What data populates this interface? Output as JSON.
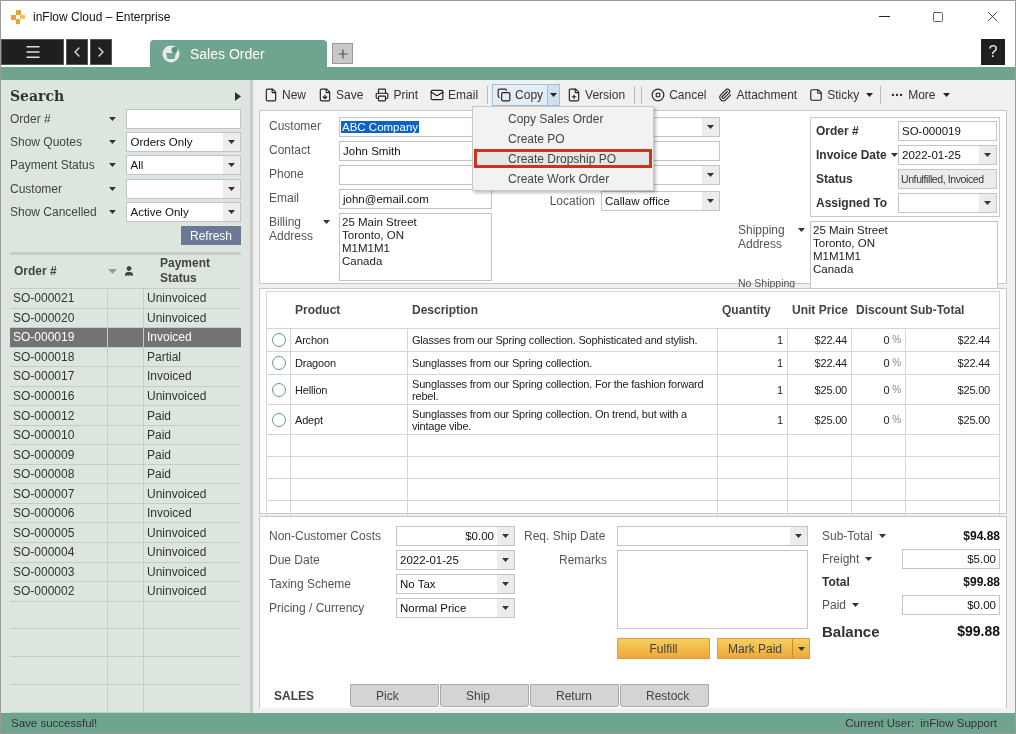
{
  "window": {
    "title": "inFlow Cloud – Enterprise"
  },
  "tabs": [
    {
      "label": "Sales Order",
      "selected": true
    }
  ],
  "help": "?",
  "search": {
    "title": "Search",
    "filters": [
      {
        "label": "Order #",
        "kind": "text"
      },
      {
        "label": "Show Quotes",
        "value": "Orders Only",
        "kind": "select"
      },
      {
        "label": "Payment Status",
        "value": "All",
        "kind": "select"
      },
      {
        "label": "Customer",
        "kind": "select"
      },
      {
        "label": "Show Cancelled",
        "value": "Active Only",
        "kind": "select"
      }
    ],
    "refresh": "Refresh"
  },
  "order_list": {
    "columns": [
      "Order #",
      "Payment Status"
    ],
    "rows": [
      {
        "order": "SO-000021",
        "status": "Uninvoiced",
        "selected": false
      },
      {
        "order": "SO-000020",
        "status": "Uninvoiced",
        "selected": false
      },
      {
        "order": "SO-000019",
        "status": "Invoiced",
        "selected": true
      },
      {
        "order": "SO-000018",
        "status": "Partial",
        "selected": false
      },
      {
        "order": "SO-000017",
        "status": "Invoiced",
        "selected": false
      },
      {
        "order": "SO-000016",
        "status": "Uninvoiced",
        "selected": false
      },
      {
        "order": "SO-000012",
        "status": "Paid",
        "selected": false
      },
      {
        "order": "SO-000010",
        "status": "Paid",
        "selected": false
      },
      {
        "order": "SO-000009",
        "status": "Paid",
        "selected": false
      },
      {
        "order": "SO-000008",
        "status": "Paid",
        "selected": false
      },
      {
        "order": "SO-000007",
        "status": "Uninvoiced",
        "selected": false
      },
      {
        "order": "SO-000006",
        "status": "Invoiced",
        "selected": false
      },
      {
        "order": "SO-000005",
        "status": "Uninvoiced",
        "selected": false
      },
      {
        "order": "SO-000004",
        "status": "Uninvoiced",
        "selected": false
      },
      {
        "order": "SO-000003",
        "status": "Uninvoiced",
        "selected": false
      },
      {
        "order": "SO-000002",
        "status": "Uninvoiced",
        "selected": false
      }
    ]
  },
  "toolbar": [
    {
      "label": "New",
      "has_menu": false,
      "open": false
    },
    {
      "label": "Save",
      "has_menu": false,
      "open": false
    },
    {
      "label": "Print",
      "has_menu": false,
      "open": false
    },
    {
      "label": "Email",
      "has_menu": false,
      "open": false
    },
    {
      "label": "Copy",
      "has_menu": true,
      "open": true
    },
    {
      "label": "Version",
      "has_menu": false,
      "open": false
    },
    {
      "label": "Cancel",
      "has_menu": false,
      "open": false
    },
    {
      "label": "Attachment",
      "has_menu": false,
      "open": false
    },
    {
      "label": "Sticky",
      "has_menu": true,
      "open": false
    },
    {
      "label": "More",
      "has_menu": true,
      "open": false
    }
  ],
  "copy_menu": [
    {
      "label": "Copy Sales Order",
      "selected": false
    },
    {
      "label": "Create PO",
      "selected": false
    },
    {
      "label": "Create Dropship PO",
      "selected": true
    },
    {
      "label": "Create Work Order",
      "selected": false
    }
  ],
  "customer": [
    {
      "label": "Customer",
      "value": "ABC Company",
      "kind": "highlighted",
      "menu_caret": false
    },
    {
      "label": "Contact",
      "value": "John Smith",
      "kind": "text",
      "menu_caret": false
    },
    {
      "label": "Phone",
      "kind": "text",
      "menu_caret": false
    },
    {
      "label": "Email",
      "value": "john@email.com",
      "kind": "text",
      "menu_caret": false
    },
    {
      "label": "Billing Address",
      "value": "25 Main Street\nToronto, ON\nM1M1M1\nCanada",
      "kind": "address",
      "menu_caret": true
    }
  ],
  "middle": [
    {
      "kind": "select"
    },
    {
      "kind": "text"
    },
    {
      "kind": "select"
    },
    {
      "label": "Location",
      "value": "Callaw office",
      "kind": "select"
    }
  ],
  "order_info": [
    {
      "label": "Order #",
      "value": "SO-000019",
      "kind": "text",
      "menu_caret": false
    },
    {
      "label": "Invoice Date",
      "value": "2022-01-25",
      "kind": "select",
      "menu_caret": true
    },
    {
      "label": "Status",
      "value": "Unfulfilled, Invoiced",
      "kind": "readonly",
      "menu_caret": false
    },
    {
      "label": "Assigned To",
      "kind": "select",
      "menu_caret": false
    }
  ],
  "shipping": {
    "label": "Shipping Address",
    "value": "25 Main Street\nToronto, ON\nM1M1M1\nCanada",
    "link": "No Shipping"
  },
  "line_items": {
    "columns": [
      "Product",
      "Description",
      "Quantity",
      "Unit Price",
      "Discount",
      "Sub-Total"
    ],
    "rows": [
      {
        "checked": false,
        "product": "Archon",
        "description": "Glasses from our Spring collection. Sophisticated and stylish.",
        "quantity": "1",
        "unit_price": "$22.44",
        "discount": "0",
        "discount_unit": "%",
        "subtotal": "$22.44"
      },
      {
        "checked": false,
        "product": "Dragoon",
        "description": "Sunglasses from our Spring collection.",
        "quantity": "1",
        "unit_price": "$22.44",
        "discount": "0",
        "discount_unit": "%",
        "subtotal": "$22.44"
      },
      {
        "checked": false,
        "product": "Hellion",
        "description": "Sunglasses from our Spring collection. For the fashion forward rebel.",
        "quantity": "1",
        "unit_price": "$25.00",
        "discount": "0",
        "discount_unit": "%",
        "subtotal": "$25.00"
      },
      {
        "checked": false,
        "product": "Adept",
        "description": "Sunglasses from our Spring collection. On trend, but with a vintage vibe.",
        "quantity": "1",
        "unit_price": "$25.00",
        "discount": "0",
        "discount_unit": "%",
        "subtotal": "$25.00"
      }
    ]
  },
  "costs": [
    {
      "label": "Non-Customer Costs",
      "value": "$0.00"
    },
    {
      "label": "Due Date",
      "value": "2022-01-25"
    },
    {
      "label": "Taxing Scheme",
      "value": "No Tax"
    },
    {
      "label": "Pricing / Currency",
      "value": "Normal Price"
    }
  ],
  "req_ship_date": {
    "label": "Req. Ship Date"
  },
  "remarks": {
    "label": "Remarks"
  },
  "actions": [
    {
      "label": "Fulfill",
      "has_menu": false
    },
    {
      "label": "Mark Paid",
      "has_menu": true
    }
  ],
  "totals": [
    {
      "label": "Sub-Total",
      "value": "$94.88",
      "kind": "plain",
      "menu_caret": true
    },
    {
      "label": "Freight",
      "value": "$5.00",
      "kind": "input",
      "menu_caret": true
    },
    {
      "label": "Total",
      "value": "$99.88",
      "kind": "bold",
      "menu_caret": false
    },
    {
      "label": "Paid",
      "value": "$0.00",
      "kind": "input",
      "menu_caret": true
    },
    {
      "label": "Balance",
      "value": "$99.88",
      "kind": "large",
      "menu_caret": false
    }
  ],
  "bottom_tabs": [
    {
      "label": "SALES",
      "selected": true
    },
    {
      "label": "Pick",
      "selected": false
    },
    {
      "label": "Ship",
      "selected": false
    },
    {
      "label": "Return",
      "selected": false
    },
    {
      "label": "Restock",
      "selected": false
    }
  ],
  "status_bar": {
    "message": "Save successful!",
    "user_label": "Current User:",
    "user": "inFlow Support"
  }
}
